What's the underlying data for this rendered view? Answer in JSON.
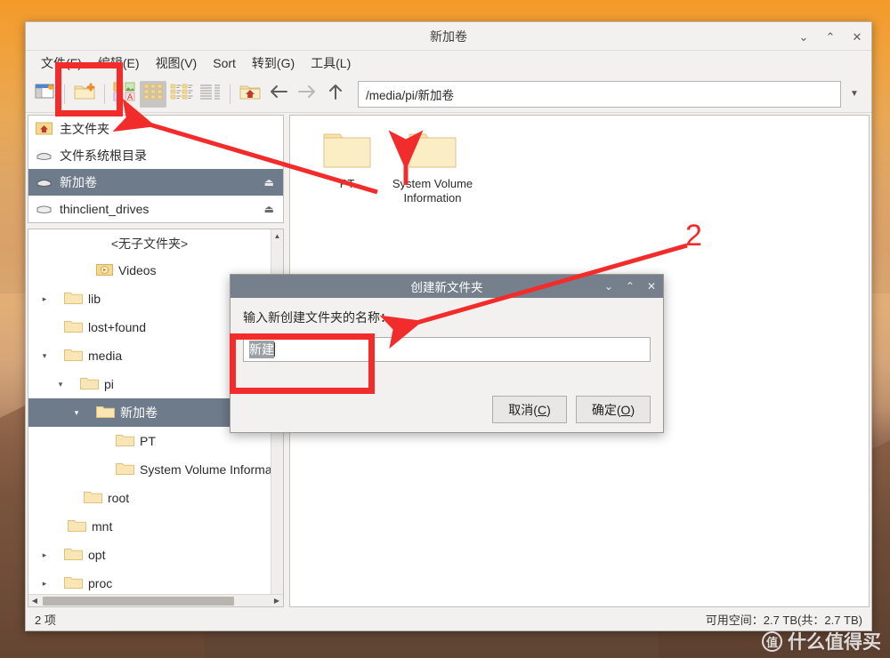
{
  "window": {
    "title": "新加卷",
    "controls": {
      "minimize": "⌄",
      "maximize": "⌃",
      "close": "✕"
    }
  },
  "menubar": [
    {
      "label": "文件(F)"
    },
    {
      "label": "编辑(E)"
    },
    {
      "label": "视图(V)"
    },
    {
      "label": "Sort"
    },
    {
      "label": "转到(G)"
    },
    {
      "label": "工具(L)"
    }
  ],
  "toolbar": {
    "buttons": [
      {
        "name": "toggle-sidebar-icon"
      },
      {
        "name": "new-folder-icon"
      },
      {
        "name": "thumbnail-view-icon"
      },
      {
        "name": "icon-view-icon"
      },
      {
        "name": "compact-view-icon"
      },
      {
        "name": "detailed-list-view-icon"
      },
      {
        "name": "home-icon"
      },
      {
        "name": "back-arrow-icon"
      },
      {
        "name": "forward-arrow-icon"
      },
      {
        "name": "up-arrow-icon"
      }
    ],
    "path_value": "/media/pi/新加卷",
    "path_dropdown": "▼"
  },
  "sidebar": {
    "places": [
      {
        "label": "主文件夹",
        "icon": "home-folder-icon",
        "selected": false,
        "eject": false
      },
      {
        "label": "文件系统根目录",
        "icon": "drive-icon",
        "selected": false,
        "eject": false
      },
      {
        "label": "新加卷",
        "icon": "drive-icon",
        "selected": true,
        "eject": true
      },
      {
        "label": "thinclient_drives",
        "icon": "drive-icon",
        "selected": false,
        "eject": true
      }
    ],
    "tree_title": "<无子文件夹>",
    "tree": [
      {
        "label": "Videos",
        "indent": 3,
        "twisty": "",
        "icon": "videos-folder-icon",
        "selected": false
      },
      {
        "label": "lib",
        "indent": 1,
        "twisty": "▸",
        "icon": "folder-icon",
        "selected": false
      },
      {
        "label": "lost+found",
        "indent": 2,
        "twisty": "",
        "icon": "folder-icon",
        "selected": false
      },
      {
        "label": "media",
        "indent": 1,
        "twisty": "▾",
        "icon": "folder-icon",
        "selected": false
      },
      {
        "label": "pi",
        "indent": 2,
        "twisty": "▾",
        "icon": "folder-icon",
        "selected": false
      },
      {
        "label": "新加卷",
        "indent": 3,
        "twisty": "▾",
        "icon": "folder-icon",
        "selected": true
      },
      {
        "label": "PT",
        "indent": 5,
        "twisty": "",
        "icon": "folder-icon",
        "selected": false
      },
      {
        "label": "System Volume Informa",
        "indent": 5,
        "twisty": "",
        "icon": "folder-icon",
        "selected": false
      },
      {
        "label": "root",
        "indent": 3,
        "twisty": "",
        "icon": "folder-icon",
        "selected": false
      },
      {
        "label": "mnt",
        "indent": 2,
        "twisty": "",
        "icon": "folder-icon",
        "selected": false
      },
      {
        "label": "opt",
        "indent": 1,
        "twisty": "▸",
        "icon": "folder-icon",
        "selected": false
      },
      {
        "label": "proc",
        "indent": 1,
        "twisty": "▸",
        "icon": "folder-icon",
        "selected": false
      }
    ]
  },
  "content": {
    "files": [
      {
        "label": "PT",
        "icon": "folder-icon"
      },
      {
        "label": "System Volume Information",
        "icon": "folder-icon"
      }
    ]
  },
  "statusbar": {
    "left": "2 项",
    "right": "可用空间：2.7 TB(共：2.7 TB)"
  },
  "dialog": {
    "title": "创建新文件夹",
    "label": "输入新创建文件夹的名称：",
    "input_value": "新建",
    "buttons": [
      {
        "label_prefix": "取消(",
        "accel": "C",
        "label_suffix": ")",
        "name": "cancel-button"
      },
      {
        "label_prefix": "确定(",
        "accel": "O",
        "label_suffix": ")",
        "name": "ok-button"
      }
    ],
    "controls": {
      "minimize": "⌄",
      "maximize": "⌃",
      "close": "✕"
    }
  },
  "annotations": {
    "number_two": "2",
    "highlight_color": "#f22b2b"
  },
  "watermark": {
    "badge": "值",
    "text": "什么值得买"
  }
}
